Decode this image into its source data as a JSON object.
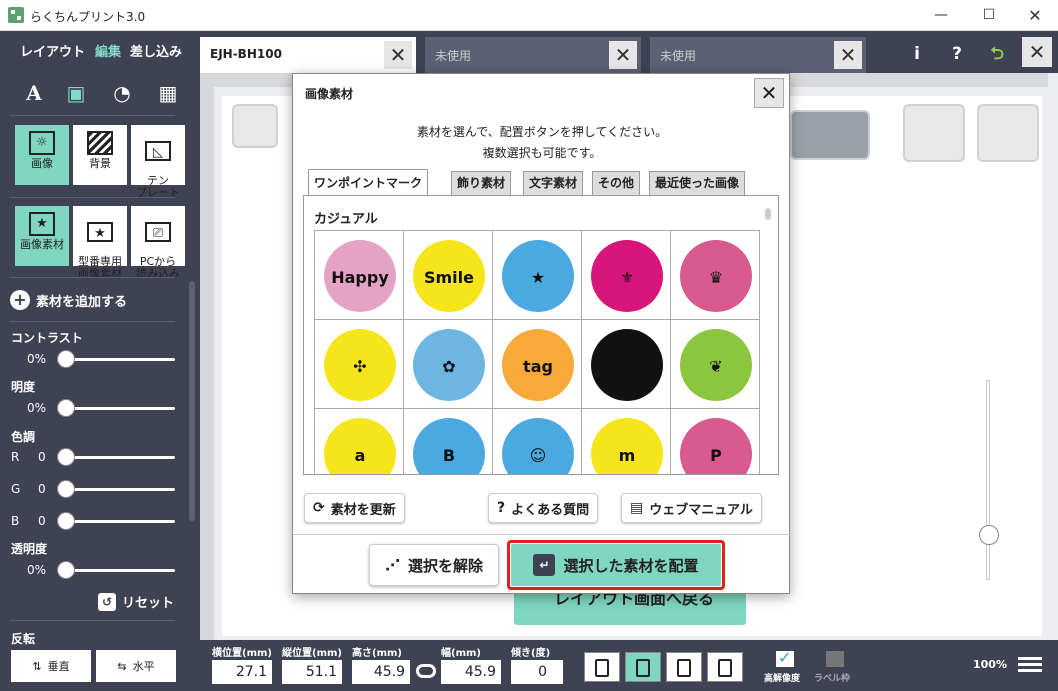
{
  "window": {
    "title": "らくちんプリント3.0",
    "minimize": "—",
    "maximize": "☐",
    "close": "✕"
  },
  "sidebar": {
    "modes": [
      "レイアウト",
      "編集",
      "差し込み"
    ],
    "tools": [
      "A",
      "▣",
      "◔",
      "▦"
    ],
    "buttons_row1": [
      {
        "label": "画像"
      },
      {
        "label": "背景"
      },
      {
        "label": "テン\nプレート"
      }
    ],
    "buttons_row2": [
      {
        "label": "画像素材"
      },
      {
        "label": "型番専用\n画像素材"
      },
      {
        "label": "PCから\n読み込み"
      }
    ],
    "add_material": "素材を追加する",
    "contrast": {
      "label": "コントラスト",
      "value": "0%"
    },
    "brightness": {
      "label": "明度",
      "value": "0%"
    },
    "hue": {
      "label": "色調",
      "r_label": "R",
      "r": "0",
      "g_label": "G",
      "g": "0",
      "b_label": "B",
      "b": "0"
    },
    "opacity": {
      "label": "透明度",
      "value": "0%"
    },
    "reset": "リセット",
    "flip": {
      "label": "反転",
      "vertical": "垂直",
      "horizontal": "水平"
    }
  },
  "tabs": [
    {
      "name": "EJH-BH100",
      "active": true
    },
    {
      "name": "未使用",
      "active": false
    },
    {
      "name": "未使用",
      "active": false
    }
  ],
  "tab_close": "✕",
  "header_right": {
    "info": "i",
    "help": "?",
    "back": "⮌",
    "close": "✕"
  },
  "canvas": {
    "back_to_layout": "レイアウト画面へ戻る",
    "zoom_plus": "+",
    "zoom_minus": "−"
  },
  "bottom": {
    "x_label": "横位置(mm)",
    "x": "27.1",
    "y_label": "縦位置(mm)",
    "y": "51.1",
    "h_label": "高さ(mm)",
    "h": "45.9",
    "w_label": "幅(mm)",
    "w": "45.9",
    "tilt_label": "傾き(度)",
    "tilt": "0",
    "hires": "高解像度",
    "labelframe": "ラベル枠",
    "zoom": "100%"
  },
  "dialog": {
    "title": "画像素材",
    "close": "✕",
    "instruction_line1": "素材を選んで、配置ボタンを押してください。",
    "instruction_line2": "複数選択も可能です。",
    "tabs": [
      "ワンポイントマーク",
      "飾り素材",
      "文字素材",
      "その他",
      "最近使った画像"
    ],
    "category": "カジュアル",
    "items": [
      {
        "text": "Happy",
        "bg": "#e4a3c4"
      },
      {
        "text": "Smile",
        "bg": "#f5e51a"
      },
      {
        "text": "★",
        "bg": "#4aa9e0"
      },
      {
        "text": "⚜",
        "bg": "#d8157a"
      },
      {
        "text": "♛",
        "bg": "#d85a8e"
      },
      {
        "text": "✣",
        "bg": "#f5e51a"
      },
      {
        "text": "✿",
        "bg": "#6db6e2"
      },
      {
        "text": "tag",
        "bg": "#f7a93a"
      },
      {
        "text": "★",
        "bg": "#111111"
      },
      {
        "text": "❦",
        "bg": "#8cc63e"
      },
      {
        "text": "a",
        "bg": "#f5e51a"
      },
      {
        "text": "B",
        "bg": "#4aa9e0"
      },
      {
        "text": "☺",
        "bg": "#4aa9e0"
      },
      {
        "text": "m",
        "bg": "#f5e51a"
      },
      {
        "text": "P",
        "bg": "#d85a8e"
      }
    ],
    "refresh": "素材を更新",
    "faq": "よくある質問",
    "manual": "ウェブマニュアル",
    "unselect": "選択を解除",
    "place": "選択した素材を配置"
  }
}
